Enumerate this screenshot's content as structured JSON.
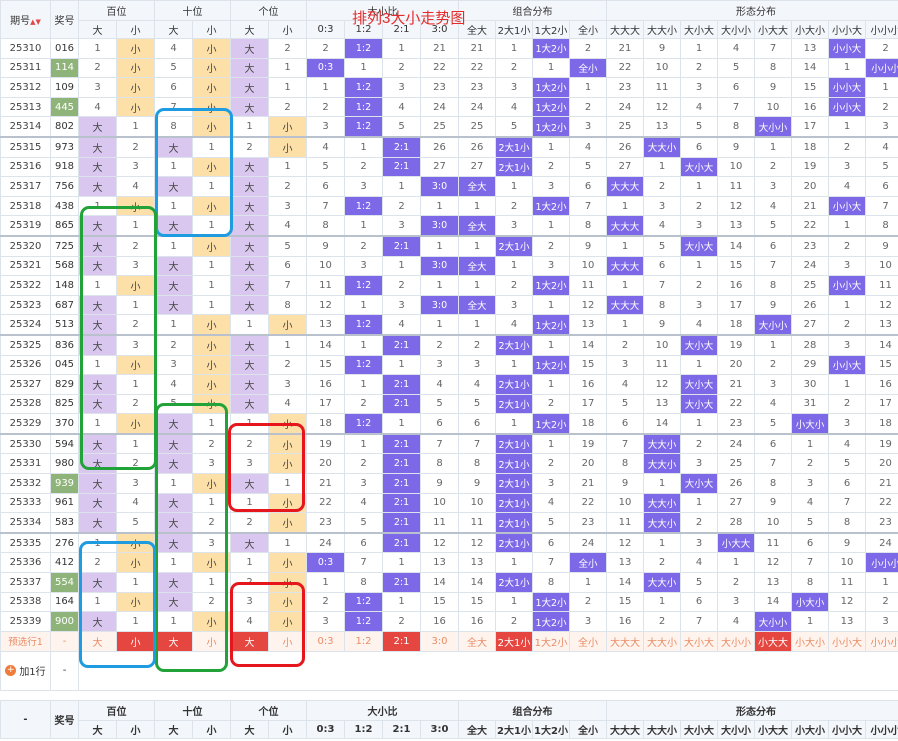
{
  "title": "排列3大小走势图",
  "header": {
    "period": "期号",
    "sort_glyph": "▲▼",
    "award": "奖号",
    "positions": [
      "百位",
      "十位",
      "个位"
    ],
    "da": "大",
    "xiao": "小",
    "ratio_group": "大小比",
    "ratio_cols": [
      "0:3",
      "1:2",
      "2:1",
      "3:0"
    ],
    "combo_group": "组合分布",
    "combo_cols": [
      "全大",
      "2大1小",
      "1大2小",
      "全小"
    ],
    "form_group": "形态分布",
    "form_cols": [
      "大大大",
      "大大小",
      "大小大",
      "大小小",
      "小大大",
      "小大小",
      "小小大",
      "小小小"
    ]
  },
  "rows": [
    {
      "p": "25310",
      "n": "016",
      "g": 0,
      "b": [
        1,
        "小"
      ],
      "s": [
        4,
        "小"
      ],
      "u": [
        "大",
        2
      ],
      "r": [
        2,
        "1:2",
        1,
        21
      ],
      "c": [
        21,
        1,
        "1大2小",
        2
      ],
      "f": [
        21,
        9,
        1,
        4,
        7,
        13,
        "小小大",
        2
      ]
    },
    {
      "p": "25311",
      "n": "114",
      "g": 1,
      "b": [
        2,
        "小"
      ],
      "s": [
        5,
        "小"
      ],
      "u": [
        "大",
        1
      ],
      "r": [
        "0:3",
        1,
        2,
        22
      ],
      "c": [
        22,
        2,
        1,
        "全小"
      ],
      "f": [
        22,
        10,
        2,
        5,
        8,
        14,
        1,
        "小小小"
      ]
    },
    {
      "p": "25312",
      "n": "109",
      "g": 0,
      "b": [
        3,
        "小"
      ],
      "s": [
        6,
        "小"
      ],
      "u": [
        "大",
        1
      ],
      "r": [
        1,
        "1:2",
        3,
        23
      ],
      "c": [
        23,
        3,
        "1大2小",
        1
      ],
      "f": [
        23,
        11,
        3,
        6,
        9,
        15,
        "小小大",
        1
      ]
    },
    {
      "p": "25313",
      "n": "445",
      "g": 1,
      "b": [
        4,
        "小"
      ],
      "s": [
        7,
        "小"
      ],
      "u": [
        "大",
        2
      ],
      "r": [
        2,
        "1:2",
        4,
        24
      ],
      "c": [
        24,
        4,
        "1大2小",
        2
      ],
      "f": [
        24,
        12,
        4,
        7,
        10,
        16,
        "小小大",
        2
      ]
    },
    {
      "p": "25314",
      "n": "802",
      "g": 0,
      "b": [
        "大",
        1
      ],
      "s": [
        8,
        "小"
      ],
      "u": [
        1,
        "小"
      ],
      "r": [
        3,
        "1:2",
        5,
        25
      ],
      "c": [
        25,
        5,
        "1大2小",
        3
      ],
      "f": [
        25,
        13,
        5,
        8,
        "大小小",
        17,
        1,
        3
      ]
    },
    {
      "p": "25315",
      "n": "973",
      "g": 0,
      "b": [
        "大",
        2
      ],
      "s": [
        "大",
        1
      ],
      "u": [
        2,
        "小"
      ],
      "r": [
        4,
        1,
        "2:1",
        26
      ],
      "c": [
        26,
        "2大1小",
        1,
        4
      ],
      "f": [
        26,
        "大大小",
        6,
        9,
        1,
        18,
        2,
        4
      ]
    },
    {
      "p": "25316",
      "n": "918",
      "g": 0,
      "b": [
        "大",
        3
      ],
      "s": [
        1,
        "小"
      ],
      "u": [
        "大",
        1
      ],
      "r": [
        5,
        2,
        "2:1",
        27
      ],
      "c": [
        27,
        "2大1小",
        2,
        5
      ],
      "f": [
        27,
        1,
        "大小大",
        10,
        2,
        19,
        3,
        5
      ]
    },
    {
      "p": "25317",
      "n": "756",
      "g": 0,
      "b": [
        "大",
        4
      ],
      "s": [
        "大",
        1
      ],
      "u": [
        "大",
        2
      ],
      "r": [
        6,
        3,
        1,
        "3:0"
      ],
      "c": [
        "全大",
        1,
        3,
        6
      ],
      "f": [
        "大大大",
        2,
        1,
        11,
        3,
        20,
        4,
        6
      ]
    },
    {
      "p": "25318",
      "n": "438",
      "g": 0,
      "b": [
        1,
        "小"
      ],
      "s": [
        1,
        "小"
      ],
      "u": [
        "大",
        3
      ],
      "r": [
        7,
        "1:2",
        2,
        1
      ],
      "c": [
        1,
        2,
        "1大2小",
        7
      ],
      "f": [
        1,
        3,
        2,
        12,
        4,
        21,
        "小小大",
        7
      ]
    },
    {
      "p": "25319",
      "n": "865",
      "g": 0,
      "b": [
        "大",
        1
      ],
      "s": [
        "大",
        1
      ],
      "u": [
        "大",
        4
      ],
      "r": [
        8,
        1,
        3,
        "3:0"
      ],
      "c": [
        "全大",
        3,
        1,
        8
      ],
      "f": [
        "大大大",
        4,
        3,
        13,
        5,
        22,
        1,
        8
      ]
    },
    {
      "p": "25320",
      "n": "725",
      "g": 0,
      "b": [
        "大",
        2
      ],
      "s": [
        1,
        "小"
      ],
      "u": [
        "大",
        5
      ],
      "r": [
        9,
        2,
        "2:1",
        1
      ],
      "c": [
        1,
        "2大1小",
        2,
        9
      ],
      "f": [
        1,
        5,
        "大小大",
        14,
        6,
        23,
        2,
        9
      ]
    },
    {
      "p": "25321",
      "n": "568",
      "g": 0,
      "b": [
        "大",
        3
      ],
      "s": [
        "大",
        1
      ],
      "u": [
        "大",
        6
      ],
      "r": [
        10,
        3,
        1,
        "3:0"
      ],
      "c": [
        "全大",
        1,
        3,
        10
      ],
      "f": [
        "大大大",
        6,
        1,
        15,
        7,
        24,
        3,
        10
      ]
    },
    {
      "p": "25322",
      "n": "148",
      "g": 0,
      "b": [
        1,
        "小"
      ],
      "s": [
        "大",
        1
      ],
      "u": [
        "大",
        7
      ],
      "r": [
        11,
        "1:2",
        2,
        1
      ],
      "c": [
        1,
        2,
        "1大2小",
        11
      ],
      "f": [
        1,
        7,
        2,
        16,
        8,
        25,
        "小小大",
        11
      ]
    },
    {
      "p": "25323",
      "n": "687",
      "g": 0,
      "b": [
        "大",
        1
      ],
      "s": [
        "大",
        1
      ],
      "u": [
        "大",
        8
      ],
      "r": [
        12,
        1,
        3,
        "3:0"
      ],
      "c": [
        "全大",
        3,
        1,
        12
      ],
      "f": [
        "大大大",
        8,
        3,
        17,
        9,
        26,
        1,
        12
      ]
    },
    {
      "p": "25324",
      "n": "513",
      "g": 0,
      "b": [
        "大",
        2
      ],
      "s": [
        1,
        "小"
      ],
      "u": [
        1,
        "小"
      ],
      "r": [
        13,
        "1:2",
        4,
        1
      ],
      "c": [
        1,
        4,
        "1大2小",
        13
      ],
      "f": [
        1,
        9,
        4,
        18,
        "大小小",
        27,
        2,
        13
      ]
    },
    {
      "p": "25325",
      "n": "836",
      "g": 0,
      "b": [
        "大",
        3
      ],
      "s": [
        2,
        "小"
      ],
      "u": [
        "大",
        1
      ],
      "r": [
        14,
        1,
        "2:1",
        2
      ],
      "c": [
        2,
        "2大1小",
        1,
        14
      ],
      "f": [
        2,
        10,
        "大小大",
        19,
        1,
        28,
        3,
        14
      ]
    },
    {
      "p": "25326",
      "n": "045",
      "g": 0,
      "b": [
        1,
        "小"
      ],
      "s": [
        3,
        "小"
      ],
      "u": [
        "大",
        2
      ],
      "r": [
        15,
        "1:2",
        1,
        3
      ],
      "c": [
        3,
        1,
        "1大2小",
        15
      ],
      "f": [
        3,
        11,
        1,
        20,
        2,
        29,
        "小小大",
        15
      ]
    },
    {
      "p": "25327",
      "n": "829",
      "g": 0,
      "b": [
        "大",
        1
      ],
      "s": [
        4,
        "小"
      ],
      "u": [
        "大",
        3
      ],
      "r": [
        16,
        1,
        "2:1",
        4
      ],
      "c": [
        4,
        "2大1小",
        1,
        16
      ],
      "f": [
        4,
        12,
        "大小大",
        21,
        3,
        30,
        1,
        16
      ]
    },
    {
      "p": "25328",
      "n": "825",
      "g": 0,
      "b": [
        "大",
        2
      ],
      "s": [
        5,
        "小"
      ],
      "u": [
        "大",
        4
      ],
      "r": [
        17,
        2,
        "2:1",
        5
      ],
      "c": [
        5,
        "2大1小",
        2,
        17
      ],
      "f": [
        5,
        13,
        "大小大",
        22,
        4,
        31,
        2,
        17
      ]
    },
    {
      "p": "25329",
      "n": "370",
      "g": 0,
      "b": [
        1,
        "小"
      ],
      "s": [
        "大",
        1
      ],
      "u": [
        1,
        "小"
      ],
      "r": [
        18,
        "1:2",
        1,
        6
      ],
      "c": [
        6,
        1,
        "1大2小",
        18
      ],
      "f": [
        6,
        14,
        1,
        23,
        5,
        "小大小",
        3,
        18
      ]
    },
    {
      "p": "25330",
      "n": "594",
      "g": 0,
      "b": [
        "大",
        1
      ],
      "s": [
        "大",
        2
      ],
      "u": [
        2,
        "小"
      ],
      "r": [
        19,
        1,
        "2:1",
        7
      ],
      "c": [
        7,
        "2大1小",
        1,
        19
      ],
      "f": [
        7,
        "大大小",
        2,
        24,
        6,
        1,
        4,
        19
      ]
    },
    {
      "p": "25331",
      "n": "980",
      "g": 0,
      "b": [
        "大",
        2
      ],
      "s": [
        "大",
        3
      ],
      "u": [
        3,
        "小"
      ],
      "r": [
        20,
        2,
        "2:1",
        8
      ],
      "c": [
        8,
        "2大1小",
        2,
        20
      ],
      "f": [
        8,
        "大大小",
        3,
        25,
        7,
        2,
        5,
        20
      ]
    },
    {
      "p": "25332",
      "n": "939",
      "g": 1,
      "b": [
        "大",
        3
      ],
      "s": [
        1,
        "小"
      ],
      "u": [
        "大",
        1
      ],
      "r": [
        21,
        3,
        "2:1",
        9
      ],
      "c": [
        9,
        "2大1小",
        3,
        21
      ],
      "f": [
        9,
        1,
        "大小大",
        26,
        8,
        3,
        6,
        21
      ]
    },
    {
      "p": "25333",
      "n": "961",
      "g": 0,
      "b": [
        "大",
        4
      ],
      "s": [
        "大",
        1
      ],
      "u": [
        1,
        "小"
      ],
      "r": [
        22,
        4,
        "2:1",
        10
      ],
      "c": [
        10,
        "2大1小",
        4,
        22
      ],
      "f": [
        10,
        "大大小",
        1,
        27,
        9,
        4,
        7,
        22
      ]
    },
    {
      "p": "25334",
      "n": "583",
      "g": 0,
      "b": [
        "大",
        5
      ],
      "s": [
        "大",
        2
      ],
      "u": [
        2,
        "小"
      ],
      "r": [
        23,
        5,
        "2:1",
        11
      ],
      "c": [
        11,
        "2大1小",
        5,
        23
      ],
      "f": [
        11,
        "大大小",
        2,
        28,
        10,
        5,
        8,
        23
      ]
    },
    {
      "p": "25335",
      "n": "276",
      "g": 0,
      "b": [
        1,
        "小"
      ],
      "s": [
        "大",
        3
      ],
      "u": [
        "大",
        1
      ],
      "r": [
        24,
        6,
        "2:1",
        12
      ],
      "c": [
        12,
        "2大1小",
        6,
        24
      ],
      "f": [
        12,
        1,
        3,
        "小大大",
        11,
        6,
        9,
        24
      ]
    },
    {
      "p": "25336",
      "n": "412",
      "g": 0,
      "b": [
        2,
        "小"
      ],
      "s": [
        1,
        "小"
      ],
      "u": [
        1,
        "小"
      ],
      "r": [
        "0:3",
        7,
        1,
        13
      ],
      "c": [
        13,
        1,
        7,
        "全小"
      ],
      "f": [
        13,
        2,
        4,
        1,
        12,
        7,
        10,
        "小小小"
      ]
    },
    {
      "p": "25337",
      "n": "554",
      "g": 1,
      "b": [
        "大",
        1
      ],
      "s": [
        "大",
        1
      ],
      "u": [
        2,
        "小"
      ],
      "r": [
        1,
        8,
        "2:1",
        14
      ],
      "c": [
        14,
        "2大1小",
        8,
        1
      ],
      "f": [
        14,
        "大大小",
        5,
        2,
        13,
        8,
        11,
        1
      ]
    },
    {
      "p": "25338",
      "n": "164",
      "g": 0,
      "b": [
        1,
        "小"
      ],
      "s": [
        "大",
        2
      ],
      "u": [
        3,
        "小"
      ],
      "r": [
        2,
        "1:2",
        1,
        15
      ],
      "c": [
        15,
        1,
        "1大2小",
        2
      ],
      "f": [
        15,
        1,
        6,
        3,
        14,
        "小大小",
        12,
        2
      ]
    },
    {
      "p": "25339",
      "n": "900",
      "g": 1,
      "b": [
        "大",
        1
      ],
      "s": [
        1,
        "小"
      ],
      "u": [
        4,
        "小"
      ],
      "r": [
        3,
        "1:2",
        2,
        16
      ],
      "c": [
        16,
        2,
        "1大2小",
        3
      ],
      "f": [
        16,
        2,
        7,
        4,
        "大小小",
        1,
        13,
        3
      ]
    }
  ],
  "preview": {
    "label": "预选行1",
    "award": "-",
    "b": [
      "大",
      "小"
    ],
    "b_on": [
      false,
      true
    ],
    "s": [
      "大",
      "小"
    ],
    "s_on": [
      true,
      false
    ],
    "u": [
      "大",
      "小"
    ],
    "u_on": [
      true,
      false
    ],
    "r": [
      "0:3",
      "1:2",
      "2:1",
      "3:0"
    ],
    "r_on": [
      false,
      false,
      true,
      false
    ],
    "c": [
      "全大",
      "2大1小",
      "1大2小",
      "全小"
    ],
    "c_on": [
      false,
      true,
      false,
      false
    ],
    "f": [
      "大大大",
      "大大小",
      "大小大",
      "大小小",
      "小大大",
      "小大小",
      "小小大",
      "小小小"
    ],
    "f_on": [
      false,
      false,
      false,
      false,
      true,
      false,
      false,
      false
    ]
  },
  "add_row": {
    "label": "加1行",
    "plus": "+",
    "award": "-"
  },
  "footer": {
    "period": "-",
    "award": "奖号"
  },
  "colors": {
    "accent": "#7d68e8",
    "da": "#d9c7ef",
    "xiao": "#fde0a8",
    "title": "#e52b2b",
    "group_box_green": "#21a33a",
    "group_box_blue": "#1f9ce0",
    "group_box_red": "#e5171d"
  }
}
